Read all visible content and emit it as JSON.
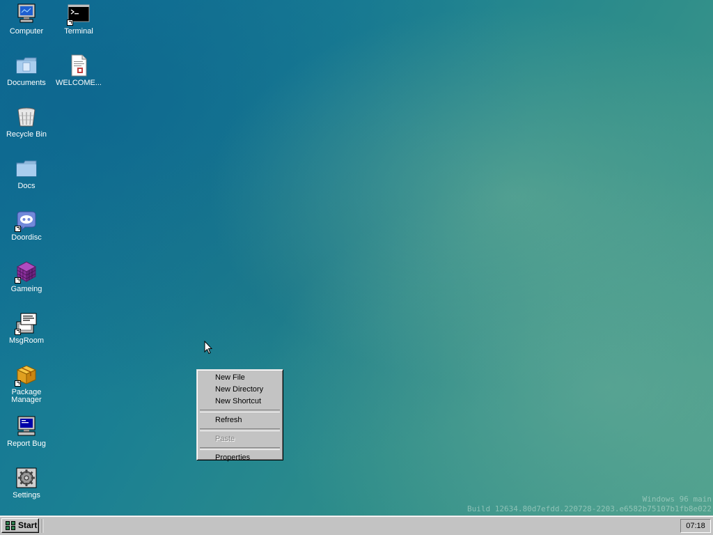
{
  "desktop": {
    "icons": [
      {
        "label": "Computer",
        "icon": "computer-icon"
      },
      {
        "label": "Terminal",
        "icon": "terminal-icon"
      },
      {
        "label": "Documents",
        "icon": "documents-folder-icon"
      },
      {
        "label": "WELCOME...",
        "icon": "text-document-icon"
      },
      {
        "label": "Recycle Bin",
        "icon": "recycle-bin-icon"
      },
      {
        "label": "Docs",
        "icon": "folder-icon"
      },
      {
        "label": "Doordisc",
        "icon": "doordisc-icon"
      },
      {
        "label": "Gameing",
        "icon": "gameing-cube-icon"
      },
      {
        "label": "MsgRoom",
        "icon": "msgroom-icon"
      },
      {
        "label": "Package Manager",
        "icon": "package-icon"
      },
      {
        "label": "Report Bug",
        "icon": "report-bug-computer-icon"
      },
      {
        "label": "Settings",
        "icon": "settings-gear-icon"
      }
    ]
  },
  "context_menu": {
    "items": [
      {
        "label": "New File",
        "enabled": true
      },
      {
        "label": "New Directory",
        "enabled": true
      },
      {
        "label": "New Shortcut",
        "enabled": true
      },
      {
        "label": "Refresh",
        "enabled": true
      },
      {
        "label": "Paste",
        "enabled": false
      },
      {
        "label": "Properties",
        "enabled": true
      }
    ]
  },
  "watermark": {
    "line1": "Windows 96 main",
    "line2": "Build 12634.80d7efdd.220728-2203.e6582b75107b1fb8e022"
  },
  "taskbar": {
    "start_label": "Start",
    "clock": "07:18"
  },
  "colors": {
    "taskbar": "#c3c3c3",
    "desktop": "#1a7f93"
  }
}
